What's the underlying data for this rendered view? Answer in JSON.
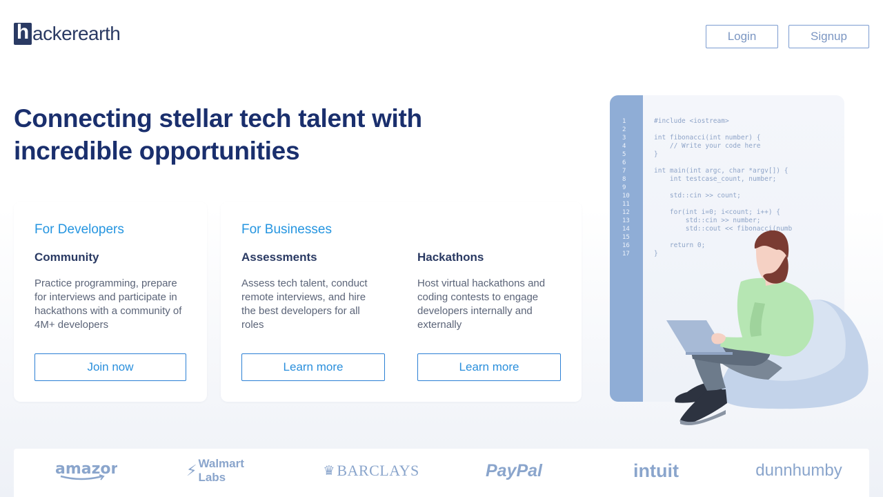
{
  "header": {
    "logo_mark": "h",
    "logo_text": "ackerearth",
    "login_label": "Login",
    "signup_label": "Signup"
  },
  "hero": {
    "title": "Connecting stellar tech talent with incredible opportunities"
  },
  "developers": {
    "heading": "For Developers",
    "community": {
      "title": "Community",
      "description": "Practice programming, prepare for interviews and participate in hackathons with a community of 4M+ developers",
      "button": "Join now"
    }
  },
  "businesses": {
    "heading": "For Businesses",
    "assessments": {
      "title": "Assessments",
      "description": "Assess tech talent, conduct remote interviews, and hire the best developers for all roles",
      "button": "Learn more"
    },
    "hackathons": {
      "title": "Hackathons",
      "description": "Host virtual hackathons and coding contests to engage developers internally and externally",
      "button": "Learn more"
    }
  },
  "code_sample": {
    "line_numbers": "1\n2\n3\n4\n5\n6\n7\n8\n9\n10\n11\n12\n13\n14\n15\n16\n17",
    "code": "#include <iostream>\n\nint fibonacci(int number) {\n    // Write your code here\n}\n\nint main(int argc, char *argv[]) {\n    int testcase_count, number;\n\n    std::cin >> count;\n\n    for(int i=0; i<count; i++) {\n        std::cin >> number;\n        std::cout << fibonacci(numb\n\n    return 0;\n}"
  },
  "partners": {
    "amazon": "amazon",
    "walmart": "Walmart Labs",
    "barclays": "BARCLAYS",
    "paypal": "PayPal",
    "intuit": "intuit",
    "dunnhumby": "dunnhumby"
  },
  "colors": {
    "brand_navy": "#1a2f6d",
    "accent_blue": "#2595e0",
    "partner_logo": "#8aa5cc",
    "code_gutter": "#8fadd6"
  }
}
